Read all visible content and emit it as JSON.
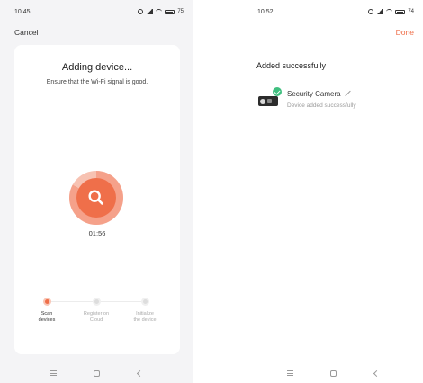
{
  "left": {
    "status_time": "10:45",
    "status_battery": "75",
    "cancel_label": "Cancel",
    "title": "Adding device...",
    "subtitle": "Ensure that the Wi-Fi signal is good.",
    "timer": "01:56",
    "progress_fraction": 0.83,
    "steps": [
      {
        "label_line1": "Scan",
        "label_line2": "devices",
        "state": "active"
      },
      {
        "label_line1": "Register on",
        "label_line2": "Cloud",
        "state": "pending"
      },
      {
        "label_line1": "Initialize",
        "label_line2": "the device",
        "state": "pending"
      }
    ]
  },
  "right": {
    "status_time": "10:52",
    "status_battery": "74",
    "done_label": "Done",
    "title": "Added successfully",
    "device": {
      "name": "Security Camera",
      "status": "Device added successfully"
    }
  },
  "colors": {
    "accent": "#ef6f4a",
    "accent_light": "#f7c2b2",
    "success": "#3fbf7f"
  }
}
